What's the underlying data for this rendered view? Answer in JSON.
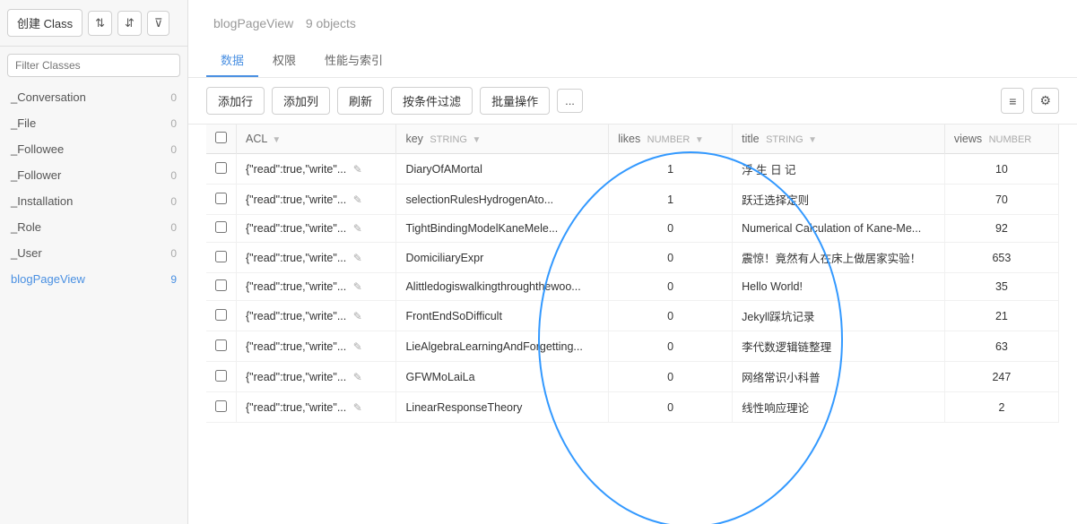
{
  "sidebar": {
    "create_label": "创建 Class",
    "filter_placeholder": "Filter Classes",
    "items": [
      {
        "name": "_Conversation",
        "count": 0,
        "active": false
      },
      {
        "name": "_File",
        "count": 0,
        "active": false
      },
      {
        "name": "_Followee",
        "count": 0,
        "active": false
      },
      {
        "name": "_Follower",
        "count": 0,
        "active": false
      },
      {
        "name": "_Installation",
        "count": 0,
        "active": false
      },
      {
        "name": "_Role",
        "count": 0,
        "active": false
      },
      {
        "name": "_User",
        "count": 0,
        "active": false
      },
      {
        "name": "blogPageView",
        "count": 9,
        "active": true
      }
    ]
  },
  "main": {
    "title": "blogPageView",
    "object_count": "9 objects",
    "tabs": [
      {
        "label": "数据",
        "active": true
      },
      {
        "label": "权限",
        "active": false
      },
      {
        "label": "性能与索引",
        "active": false
      }
    ],
    "toolbar": {
      "add_row": "添加行",
      "add_col": "添加列",
      "refresh": "刷新",
      "filter": "按条件过滤",
      "batch": "批量操作",
      "more": "..."
    },
    "columns": [
      {
        "name": "ACL",
        "type": ""
      },
      {
        "name": "key",
        "type": "STRING"
      },
      {
        "name": "likes",
        "type": "NUMBER"
      },
      {
        "name": "title",
        "type": "STRING"
      },
      {
        "name": "views",
        "type": "NUMBER"
      }
    ],
    "rows": [
      {
        "acl": "{\"read\":true,\"write\"...",
        "key": "DiaryOfAMortal",
        "likes": 1,
        "title": "浮 生 日 记",
        "views": 10
      },
      {
        "acl": "{\"read\":true,\"write\"...",
        "key": "selectionRulesHydrogenAto...",
        "likes": 1,
        "title": "跃迁选择定则",
        "views": 70
      },
      {
        "acl": "{\"read\":true,\"write\"...",
        "key": "TightBindingModelKaneMele...",
        "likes": 0,
        "title": "Numerical Calculation of Kane-Me...",
        "views": 92
      },
      {
        "acl": "{\"read\":true,\"write\"...",
        "key": "DomiciliaryExpr",
        "likes": 0,
        "title": "震惊！竟然有人在床上做居家实验！",
        "views": 653
      },
      {
        "acl": "{\"read\":true,\"write\"...",
        "key": "Alittledogiswalkingthroughthewoo...",
        "likes": 0,
        "title": "Hello World!",
        "views": 35
      },
      {
        "acl": "{\"read\":true,\"write\"...",
        "key": "FrontEndSoDifficult",
        "likes": 0,
        "title": "Jekyll踩坑记录",
        "views": 21
      },
      {
        "acl": "{\"read\":true,\"write\"...",
        "key": "LieAlgebraLearningAndForgetting...",
        "likes": 0,
        "title": "李代数逻辑链整理",
        "views": 63
      },
      {
        "acl": "{\"read\":true,\"write\"...",
        "key": "GFWMoLaiLa",
        "likes": 0,
        "title": "网络常识小科普",
        "views": 247
      },
      {
        "acl": "{\"read\":true,\"write\"...",
        "key": "LinearResponseTheory",
        "likes": 0,
        "title": "线性响应理论",
        "views": 2
      }
    ]
  }
}
